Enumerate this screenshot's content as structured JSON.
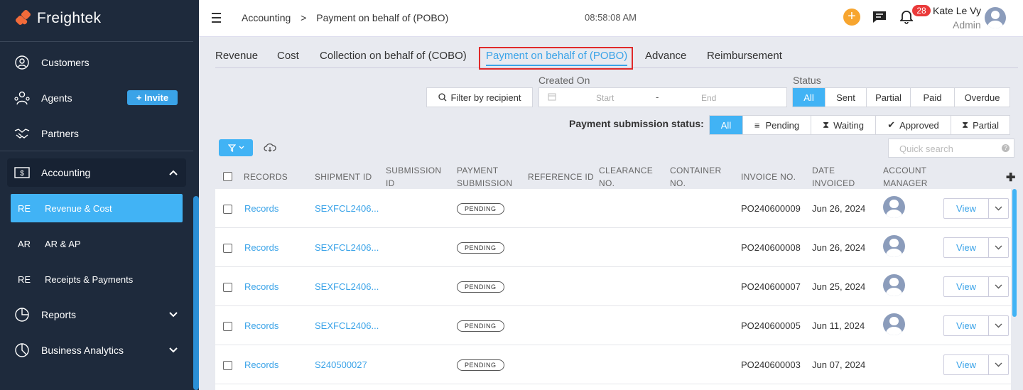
{
  "app": {
    "name": "Freightek"
  },
  "sidebar": {
    "items": [
      {
        "label": "Customers",
        "icon": "customers-icon"
      },
      {
        "label": "Agents",
        "icon": "agents-icon",
        "action": "+ Invite"
      },
      {
        "label": "Partners",
        "icon": "handshake-icon"
      },
      {
        "label": "Accounting",
        "icon": "accounting-icon"
      },
      {
        "label": "Reports",
        "icon": "pie-chart-icon"
      },
      {
        "label": "Business Analytics",
        "icon": "analytics-icon"
      }
    ],
    "accounting_sub": [
      {
        "abbr": "RE",
        "label": "Revenue & Cost",
        "active": true
      },
      {
        "abbr": "AR",
        "label": "AR & AP"
      },
      {
        "abbr": "RE",
        "label": "Receipts & Payments"
      }
    ]
  },
  "header": {
    "breadcrumb_parent": "Accounting",
    "breadcrumb_sep": ">",
    "breadcrumb_current": "Payment on behalf of (POBO)",
    "time": "08:58:08 AM",
    "notification_count": "28",
    "user_name": "Kate Le Vy",
    "user_role": "Admin"
  },
  "tabs": [
    "Revenue",
    "Cost",
    "Collection on behalf of (COBO)",
    "Payment on behalf of (POBO)",
    "Advance",
    "Reimbursement"
  ],
  "filters": {
    "recipient_btn": "Filter by recipient",
    "created_on_label": "Created On",
    "date_start_placeholder": "Start",
    "date_sep": "-",
    "date_end_placeholder": "End",
    "status_label": "Status",
    "status_options": [
      "All",
      "Sent",
      "Partial",
      "Paid",
      "Overdue"
    ],
    "submission_label": "Payment submission status:",
    "submission_options": [
      "All",
      "Pending",
      "Waiting",
      "Approved",
      "Partial"
    ],
    "quick_search_placeholder": "Quick search"
  },
  "table": {
    "headers": [
      "RECORDS",
      "SHIPMENT ID",
      "SUBMISSION ID",
      "PAYMENT SUBMISSION",
      "REFERENCE ID",
      "CLEARANCE NO.",
      "CONTAINER NO.",
      "INVOICE NO.",
      "DATE INVOICED",
      "ACCOUNT MANAGER"
    ],
    "rows": [
      {
        "records": "Records",
        "shipment_id": "SEXFCL2406...",
        "status": "PENDING",
        "invoice": "PO240600009",
        "date": "Jun 26, 2024",
        "manager_avatar": true,
        "action": "View"
      },
      {
        "records": "Records",
        "shipment_id": "SEXFCL2406...",
        "status": "PENDING",
        "invoice": "PO240600008",
        "date": "Jun 26, 2024",
        "manager_avatar": true,
        "action": "View"
      },
      {
        "records": "Records",
        "shipment_id": "SEXFCL2406...",
        "status": "PENDING",
        "invoice": "PO240600007",
        "date": "Jun 25, 2024",
        "manager_avatar": true,
        "action": "View"
      },
      {
        "records": "Records",
        "shipment_id": "SEXFCL2406...",
        "status": "PENDING",
        "invoice": "PO240600005",
        "date": "Jun 11, 2024",
        "manager_avatar": true,
        "action": "View"
      },
      {
        "records": "Records",
        "shipment_id": "S240500027",
        "status": "PENDING",
        "invoice": "PO240600003",
        "date": "Jun 07, 2024",
        "manager_avatar": false,
        "action": "View"
      }
    ]
  },
  "colors": {
    "accent": "#41b3f5",
    "sidebar": "#1e2a3c",
    "highlight": "#e02a2a",
    "brand": "#f26b3a"
  }
}
